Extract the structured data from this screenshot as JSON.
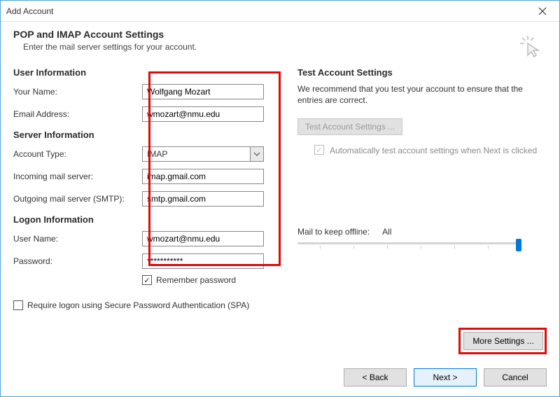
{
  "window": {
    "title": "Add Account"
  },
  "header": {
    "title": "POP and IMAP Account Settings",
    "subtitle": "Enter the mail server settings for your account."
  },
  "sections": {
    "user": "User Information",
    "server": "Server Information",
    "logon": "Logon Information"
  },
  "labels": {
    "your_name": "Your Name:",
    "email": "Email Address:",
    "account_type": "Account Type:",
    "incoming": "Incoming mail server:",
    "outgoing": "Outgoing mail server (SMTP):",
    "user_name": "User Name:",
    "password": "Password:",
    "remember": "Remember password",
    "spa": "Require logon using Secure Password Authentication (SPA)"
  },
  "values": {
    "your_name": "Wolfgang Mozart",
    "email": "wmozart@nmu.edu",
    "account_type": "IMAP",
    "incoming": "imap.gmail.com",
    "outgoing": "smtp.gmail.com",
    "user_name": "wmozart@nmu.edu",
    "password": "***********",
    "remember_checked": "✓"
  },
  "right": {
    "title": "Test Account Settings",
    "desc": "We recommend that you test your account to ensure that the entries are correct.",
    "test_btn": "Test Account Settings ...",
    "auto_test": "Automatically test account settings when Next is clicked",
    "auto_test_checked": "✓",
    "mail_offline_label": "Mail to keep offline:",
    "mail_offline_value": "All",
    "more_settings": "More Settings ..."
  },
  "footer": {
    "back": "< Back",
    "next": "Next >",
    "cancel": "Cancel"
  }
}
